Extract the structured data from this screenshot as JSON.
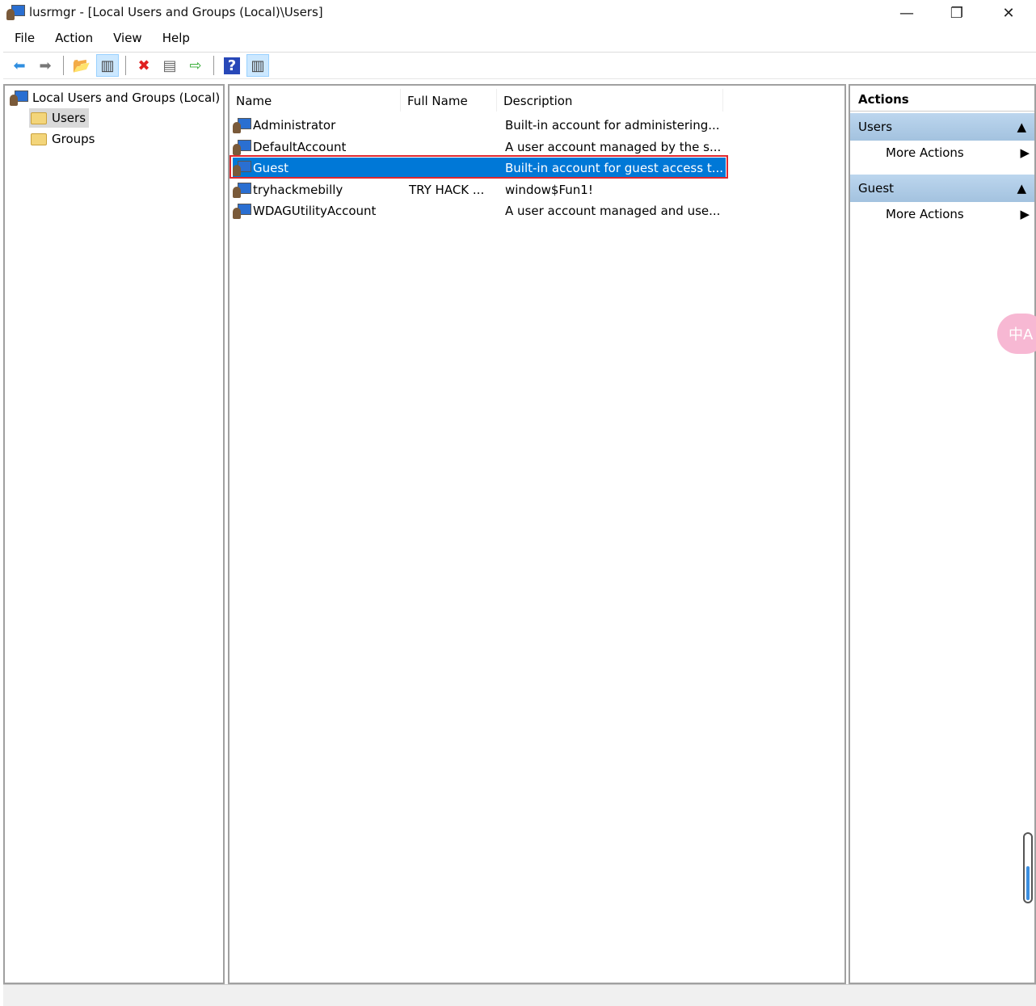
{
  "window": {
    "title": "lusrmgr - [Local Users and Groups (Local)\\Users]",
    "minimize": "—",
    "restore": "❐",
    "close": "✕"
  },
  "menu": [
    "File",
    "Action",
    "View",
    "Help"
  ],
  "toolbar": [
    {
      "icon": "back-arrow-icon",
      "glyph": "⬅",
      "color": "#2f8ee0"
    },
    {
      "icon": "forward-arrow-icon",
      "glyph": "➡",
      "color": "#777"
    },
    {
      "icon": "up-folder-icon",
      "glyph": "📂",
      "color": "#d4a020"
    },
    {
      "icon": "show-hide-tree-icon",
      "glyph": "▥",
      "color": "#444"
    },
    {
      "icon": "delete-icon",
      "glyph": "✖",
      "color": "#e02020"
    },
    {
      "icon": "properties-icon",
      "glyph": "▤",
      "color": "#666"
    },
    {
      "icon": "export-list-icon",
      "glyph": "⇨",
      "color": "#3a3"
    },
    {
      "icon": "help-icon",
      "glyph": "?",
      "color": "#fff"
    },
    {
      "icon": "show-hide-action-pane-icon",
      "glyph": "▥",
      "color": "#444"
    }
  ],
  "tree": {
    "root": "Local Users and Groups (Local)",
    "children": [
      "Users",
      "Groups"
    ],
    "selected": "Users"
  },
  "list": {
    "columns": [
      "Name",
      "Full Name",
      "Description"
    ],
    "rows": [
      {
        "name": "Administrator",
        "full_name": "",
        "description": "Built-in account for administering..."
      },
      {
        "name": "DefaultAccount",
        "full_name": "",
        "description": "A user account managed by the s..."
      },
      {
        "name": "Guest",
        "full_name": "",
        "description": "Built-in account for guest access t...",
        "selected": true
      },
      {
        "name": "tryhackmebilly",
        "full_name": "TRY HACK ...",
        "description": "window$Fun1!"
      },
      {
        "name": "WDAGUtilityAccount",
        "full_name": "",
        "description": "A user account managed and use..."
      }
    ],
    "selection_color": "#0078d7",
    "highlight_box_color": "#e0282e"
  },
  "actions": {
    "title": "Actions",
    "groups": [
      {
        "label": "Users",
        "item": "More Actions"
      },
      {
        "label": "Guest",
        "item": "More Actions"
      }
    ]
  },
  "translate_badge": "中A"
}
